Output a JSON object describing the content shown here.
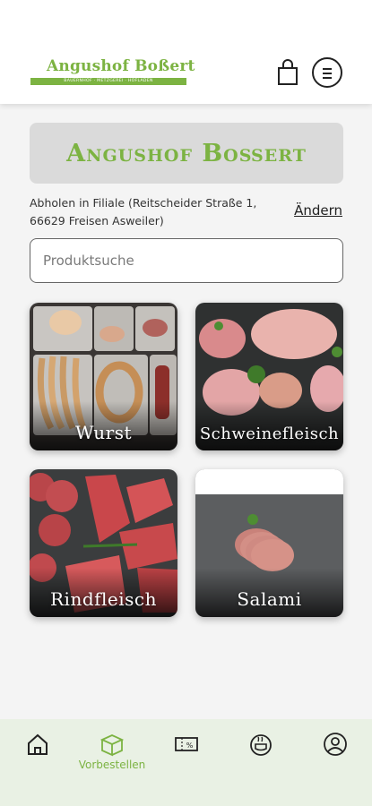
{
  "header": {
    "logo_title": "Angushof Boßert",
    "logo_subtitle": "BAUERNHOF · METZGEREI · HOFLADEN"
  },
  "store": {
    "name": "Angushof Boßert",
    "pickup": "Abholen in Filiale (Reitscheider Straße 1, 66629 Freisen Asweiler)",
    "change_label": "Ändern"
  },
  "search": {
    "placeholder": "Produktsuche",
    "value": ""
  },
  "categories": [
    {
      "label": "Wurst"
    },
    {
      "label": "Schweinefleisch"
    },
    {
      "label": "Rindfleisch"
    },
    {
      "label": "Salami"
    }
  ],
  "nav": {
    "items": [
      {
        "icon": "home-icon",
        "label": ""
      },
      {
        "icon": "box-icon",
        "label": "Vorbestellen",
        "active": true
      },
      {
        "icon": "discount-ticket-icon",
        "label": ""
      },
      {
        "icon": "recipe-pot-icon",
        "label": ""
      },
      {
        "icon": "user-icon",
        "label": ""
      }
    ]
  },
  "colors": {
    "brand_green": "#7cb342",
    "nav_background": "#e9f1e4",
    "banner_background": "#dadada"
  }
}
